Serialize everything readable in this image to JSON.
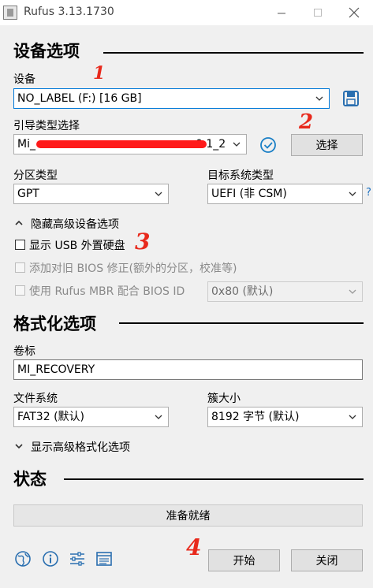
{
  "window": {
    "title": "Rufus 3.13.1730"
  },
  "device_section": {
    "title": "设备选项",
    "device_label": "设备",
    "device_value": "NO_LABEL (F:) [16 GB]",
    "boot_label": "引导类型选择",
    "boot_value_start": "Mi_",
    "boot_value_end": "0.1_2",
    "select_button": "选择",
    "partition_label": "分区类型",
    "partition_value": "GPT",
    "target_label": "目标系统类型",
    "target_value": "UEFI (非 CSM)",
    "target_help": "?",
    "advanced_toggle": "隐藏高级设备选项",
    "usb_hdd": "显示 USB 外置硬盘",
    "old_bios": "添加对旧 BIOS 修正(额外的分区，校准等)",
    "rufus_mbr": "使用 Rufus MBR 配合 BIOS ID",
    "bios_id_value": "0x80 (默认)"
  },
  "format_section": {
    "title": "格式化选项",
    "volume_label": "卷标",
    "volume_value": "MI_RECOVERY",
    "fs_label": "文件系统",
    "fs_value": "FAT32 (默认)",
    "cluster_label": "簇大小",
    "cluster_value": "8192 字节 (默认)",
    "advanced_toggle": "显示高级格式化选项"
  },
  "status_section": {
    "title": "状态",
    "status_text": "准备就绪"
  },
  "bottom": {
    "start_button": "开始",
    "close_button": "关闭",
    "icons": [
      "globe-icon",
      "info-icon",
      "settings-sliders-icon",
      "log-icon"
    ]
  },
  "annotations": [
    "1",
    "2",
    "3",
    "4"
  ],
  "colors": {
    "accent": "#0078d7",
    "annotation": "#e8291c",
    "check": "#1a7fc6"
  }
}
